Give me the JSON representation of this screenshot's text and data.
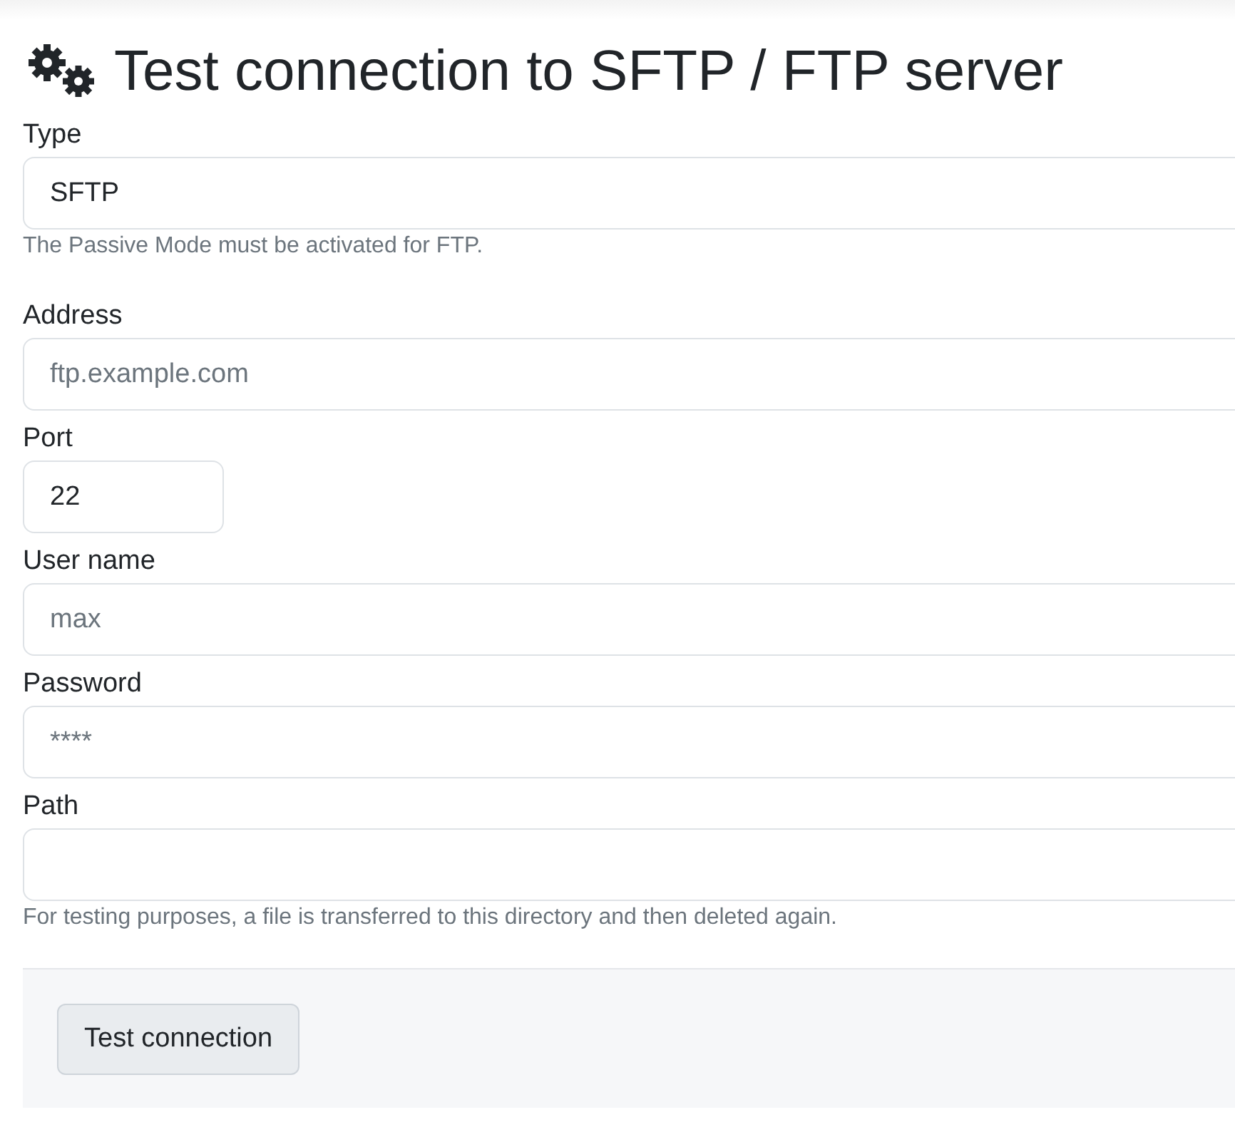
{
  "title": "Test connection to SFTP / FTP server",
  "fields": [
    {
      "label": "Type",
      "kind": "select",
      "value": "SFTP",
      "help": "The Passive Mode must be activated for FTP."
    },
    {
      "label": "Address",
      "kind": "text",
      "placeholder": "ftp.example.com"
    },
    {
      "label": "Port",
      "kind": "number",
      "value": "22"
    },
    {
      "label": "User name",
      "kind": "text",
      "placeholder": "max"
    },
    {
      "label": "Password",
      "kind": "text",
      "placeholder": "****"
    },
    {
      "label": "Path",
      "kind": "text",
      "help": "For testing purposes, a file is transferred to this directory and then deleted again."
    }
  ],
  "button": "Test connection"
}
